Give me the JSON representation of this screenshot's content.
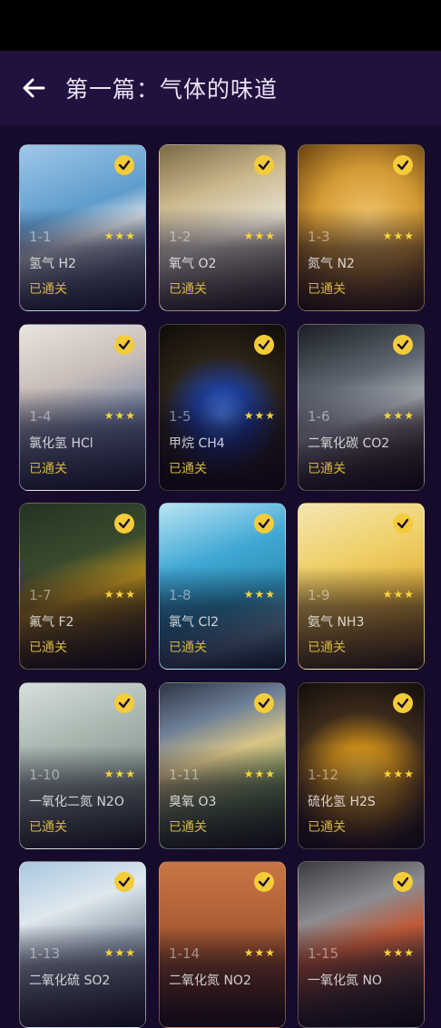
{
  "header": {
    "title": "第一篇：气体的味道"
  },
  "icons": {
    "back": "arrow-left-icon",
    "check": "check-circle-icon",
    "star": "star-icon"
  },
  "colors": {
    "background": "#170b2c",
    "header": "#22103f",
    "accent": "#f4cc3a",
    "status": "#d7b63e"
  },
  "levels": [
    {
      "num": "1-1",
      "name": "氢气 H2",
      "stars": "★★★",
      "status": "已通关"
    },
    {
      "num": "1-2",
      "name": "氧气 O2",
      "stars": "★★★",
      "status": "已通关"
    },
    {
      "num": "1-3",
      "name": "氮气 N2",
      "stars": "★★★",
      "status": "已通关"
    },
    {
      "num": "1-4",
      "name": "氯化氢 HCl",
      "stars": "★★★",
      "status": "已通关"
    },
    {
      "num": "1-5",
      "name": "甲烷 CH4",
      "stars": "★★★",
      "status": "已通关"
    },
    {
      "num": "1-6",
      "name": "二氧化碳 CO2",
      "stars": "★★★",
      "status": "已通关"
    },
    {
      "num": "1-7",
      "name": "氟气 F2",
      "stars": "★★★",
      "status": "已通关"
    },
    {
      "num": "1-8",
      "name": "氯气 Cl2",
      "stars": "★★★",
      "status": "已通关"
    },
    {
      "num": "1-9",
      "name": "氨气 NH3",
      "stars": "★★★",
      "status": "已通关"
    },
    {
      "num": "1-10",
      "name": "一氧化二氮 N2O",
      "stars": "★★★",
      "status": "已通关"
    },
    {
      "num": "1-11",
      "name": "臭氧 O3",
      "stars": "★★★",
      "status": "已通关"
    },
    {
      "num": "1-12",
      "name": "硫化氢 H2S",
      "stars": "★★★",
      "status": "已通关"
    },
    {
      "num": "1-13",
      "name": "二氧化硫 SO2",
      "stars": "★★★",
      "status": ""
    },
    {
      "num": "1-14",
      "name": "二氧化氮 NO2",
      "stars": "★★★",
      "status": ""
    },
    {
      "num": "1-15",
      "name": "一氧化氮 NO",
      "stars": "★★★",
      "status": ""
    }
  ]
}
